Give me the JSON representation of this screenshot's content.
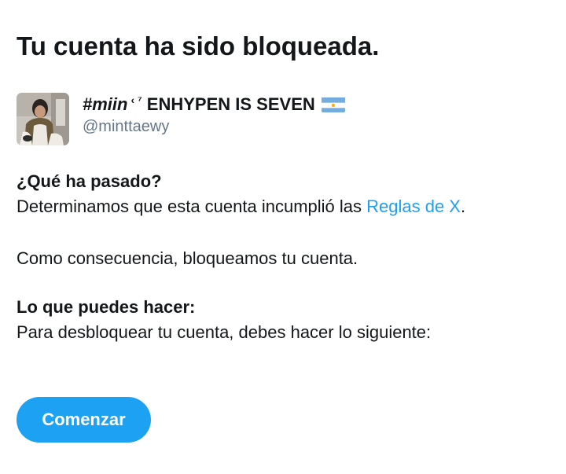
{
  "page": {
    "title": "Tu cuenta ha sido bloqueada."
  },
  "account": {
    "display_name_hashtag": "#miin",
    "display_name_decoration": "‹ ⁷",
    "display_name_rest": "ENHYPEN IS SEVEN",
    "flag_icon": "argentina-flag-icon",
    "handle": "@minttaewy",
    "avatar_icon": "profile-photo"
  },
  "what_happened": {
    "heading": "¿Qué ha pasado?",
    "text_before_link": "Determinamos que esta cuenta incumplió las ",
    "link_label": "Reglas de X",
    "text_after_link": "."
  },
  "consequence": {
    "text": "Como consecuencia, bloqueamos tu cuenta."
  },
  "what_you_can_do": {
    "heading": "Lo que puedes hacer:",
    "text": "Para desbloquear tu cuenta, debes hacer lo siguiente:"
  },
  "actions": {
    "start_label": "Comenzar"
  },
  "colors": {
    "accent": "#1da1f2",
    "text_primary": "#14171a",
    "text_secondary": "#657786"
  }
}
